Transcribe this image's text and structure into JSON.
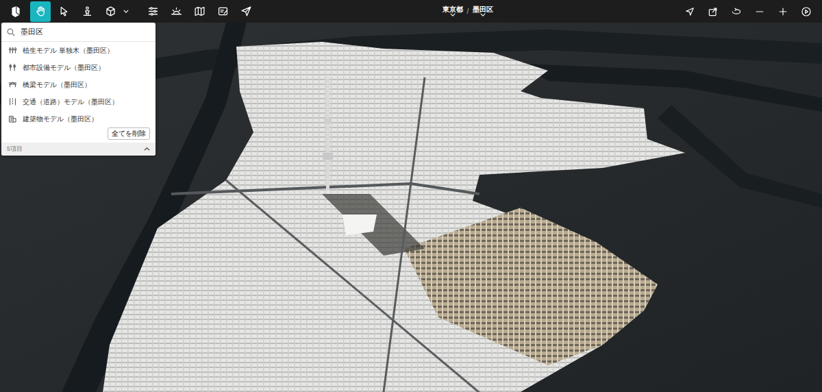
{
  "toolbar": {
    "tools": [
      {
        "kind": "hand",
        "selected": true
      },
      {
        "kind": "pointer",
        "selected": false
      },
      {
        "kind": "person",
        "selected": false
      },
      {
        "kind": "cube",
        "selected": false
      },
      {
        "kind": "sliders",
        "selected": false
      },
      {
        "kind": "horizon",
        "selected": false
      },
      {
        "kind": "map",
        "selected": false
      },
      {
        "kind": "note",
        "selected": false
      },
      {
        "kind": "send",
        "selected": false
      }
    ]
  },
  "breadcrumb": {
    "items": [
      {
        "label": "東京都"
      },
      {
        "label": "墨田区"
      }
    ],
    "separator": "/"
  },
  "search": {
    "value": "墨田区"
  },
  "layers": [
    {
      "label": "植生モデル 単独木（墨田区）",
      "kind": "tree"
    },
    {
      "label": "都市設備モデル（墨田区）",
      "kind": "lamp"
    },
    {
      "label": "橋梁モデル（墨田区）",
      "kind": "bridge"
    },
    {
      "label": "交通（道路）モデル（墨田区）",
      "kind": "road"
    },
    {
      "label": "建築物モデル（墨田区）",
      "kind": "building"
    }
  ],
  "clear_button": "全てを削除",
  "footer": {
    "count": "5項目",
    "expanded": true
  }
}
